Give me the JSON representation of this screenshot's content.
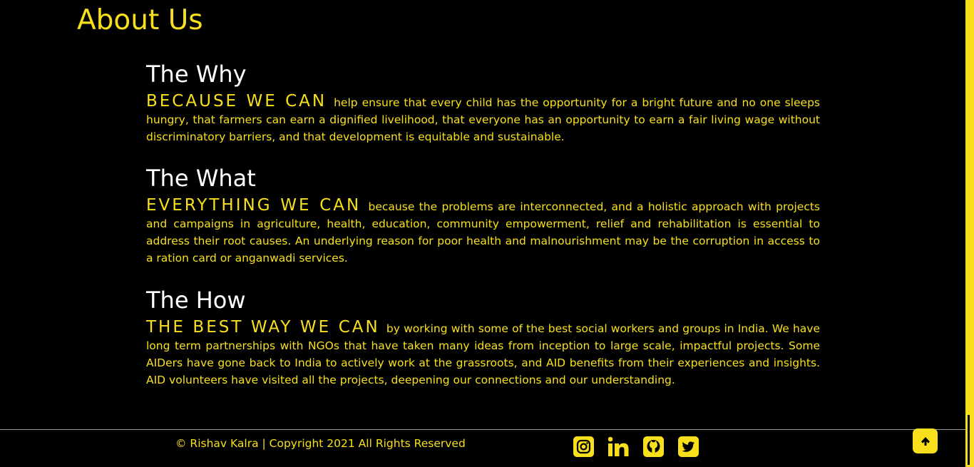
{
  "colors": {
    "accent": "#f7e01b",
    "background": "#000000",
    "heading": "#ffffff"
  },
  "about": {
    "title": "About Us",
    "sections": [
      {
        "heading": "The Why",
        "lead": "BECAUSE WE CAN",
        "body": "help ensure that every child has the opportunity for a bright future and no one sleeps hungry, that farmers can earn a dignified livelihood, that everyone has an opportunity to earn a fair living wage without discriminatory barriers, and that development is equitable and sustainable."
      },
      {
        "heading": "The What",
        "lead": "EVERYTHING WE CAN",
        "body": "because the problems are interconnected, and a holistic approach with projects and campaigns in agriculture, health, education, community empowerment, relief and rehabilitation is essential to address their root causes. An underlying reason for poor health and malnourishment may be the corruption in access to a ration card or anganwadi services."
      },
      {
        "heading": "The How",
        "lead": "THE BEST WAY WE CAN",
        "body": "by working with some of the best social workers and groups in India. We have long term partnerships with NGOs that have taken many ideas from inception to large scale, impactful projects. Some AIDers have gone back to India to actively work at the grassroots, and AID benefits from their experiences and insights. AID volunteers have visited all the projects, deepening our connections and our understanding."
      }
    ]
  },
  "footer": {
    "copyright": "© Rishav Kalra | Copyright 2021 All Rights Reserved",
    "social_icons": [
      "instagram-icon",
      "linkedin-icon",
      "github-icon",
      "twitter-icon"
    ],
    "back_to_top_icon": "arrow-up-icon"
  }
}
